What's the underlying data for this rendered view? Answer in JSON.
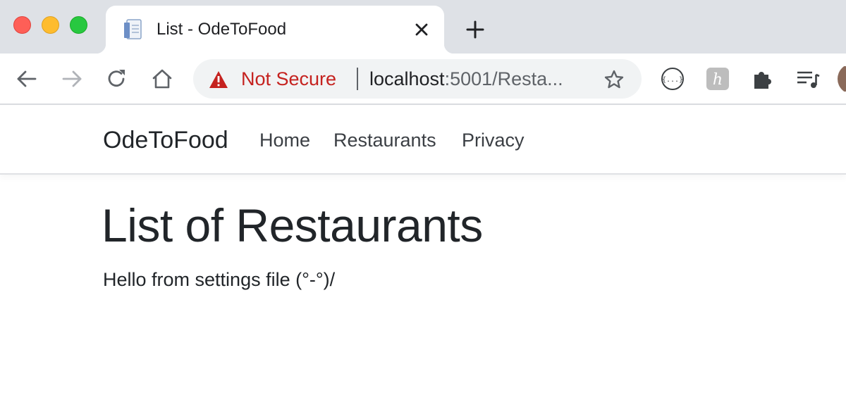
{
  "browser": {
    "tab": {
      "title": "List - OdeToFood",
      "favicon": "document-icon"
    },
    "address_bar": {
      "security_label": "Not Secure",
      "url_host": "localhost",
      "url_rest": ":5001/Resta..."
    },
    "extensions": [
      "json-viewer-icon",
      "honey-icon",
      "puzzle-icon",
      "media-playlist-icon"
    ]
  },
  "site": {
    "brand": "OdeToFood",
    "nav": [
      {
        "label": "Home"
      },
      {
        "label": "Restaurants"
      },
      {
        "label": "Privacy"
      }
    ]
  },
  "main": {
    "title": "List of Restaurants",
    "message": "Hello from settings file (°-°)/"
  },
  "colors": {
    "tabstrip": "#dee1e6",
    "not_secure": "#c5221f",
    "text": "#212529"
  }
}
